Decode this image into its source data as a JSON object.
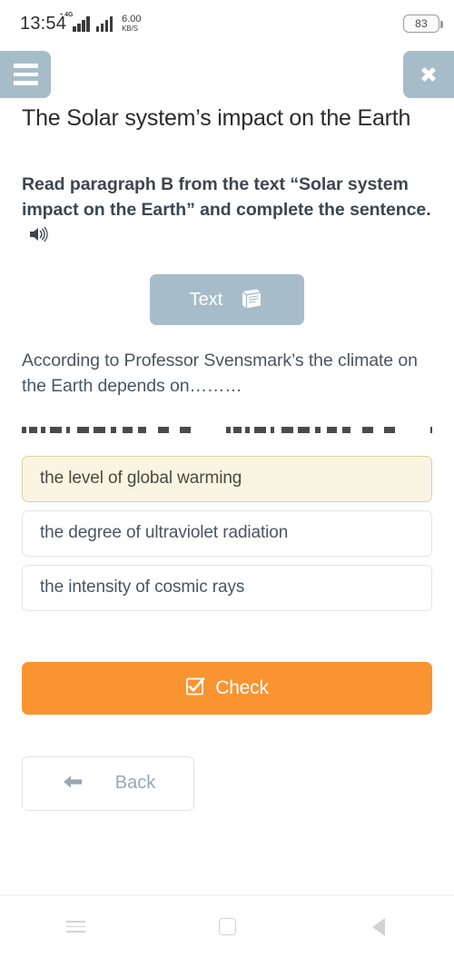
{
  "status_bar": {
    "time": "13:54",
    "network_type": "4G",
    "data_speed_value": "6.00",
    "data_speed_unit": "KB/S",
    "battery_level": "83"
  },
  "header": {
    "menu_icon": "hamburger-menu-icon",
    "close_icon": "close-x-icon"
  },
  "page": {
    "title": "The Solar system’s impact on the Earth",
    "instruction": "Read paragraph B from the text “Solar system impact on the Earth” and complete the sentence.",
    "audio_icon": "speaker-audio-icon",
    "text_button_label": "Text",
    "text_button_icon": "book-icon",
    "question": "According to Professor Svensmark’s the climate on the Earth depends on………"
  },
  "options": [
    {
      "label": "the level of global warming",
      "selected": true
    },
    {
      "label": "the degree of ultraviolet radiation",
      "selected": false
    },
    {
      "label": "the intensity of cosmic rays",
      "selected": false
    }
  ],
  "actions": {
    "check_label": "Check",
    "check_icon": "checkbox-checked-icon",
    "back_label": "Back",
    "back_icon": "arrow-left-icon"
  },
  "nav_bar": {
    "recents_icon": "recents-icon",
    "home_icon": "home-square-icon",
    "back_icon": "back-triangle-icon"
  },
  "colors": {
    "accent_orange": "#f99431",
    "header_blue_gray": "#a7bcc9",
    "selected_cream": "#faf4e3",
    "selected_border": "#dccf9f",
    "option_border": "#e2e4e6",
    "muted_text": "#9aa7b3"
  }
}
